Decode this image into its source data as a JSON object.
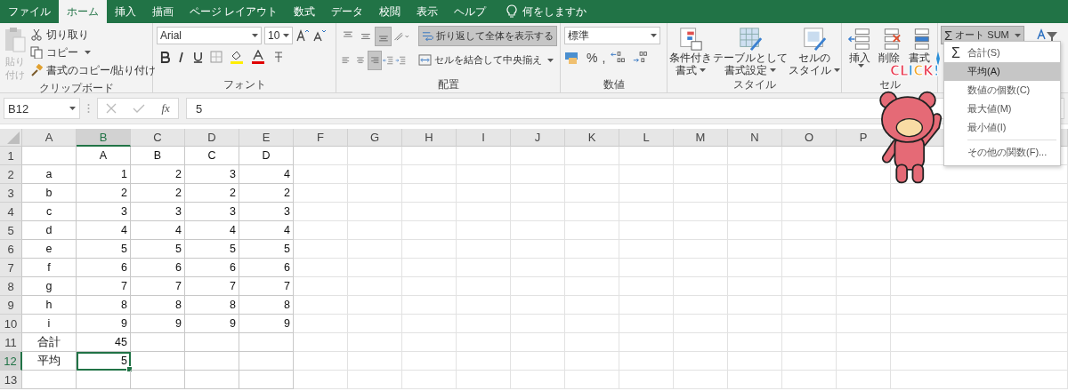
{
  "tabs": [
    {
      "label": "ファイル",
      "selected": false
    },
    {
      "label": "ホーム",
      "selected": true
    },
    {
      "label": "挿入",
      "selected": false
    },
    {
      "label": "描画",
      "selected": false
    },
    {
      "label": "ページ レイアウト",
      "selected": false
    },
    {
      "label": "数式",
      "selected": false
    },
    {
      "label": "データ",
      "selected": false
    },
    {
      "label": "校閲",
      "selected": false
    },
    {
      "label": "表示",
      "selected": false
    },
    {
      "label": "ヘルプ",
      "selected": false
    }
  ],
  "tell_me": "何をしますか",
  "ribbon": {
    "clipboard": {
      "label": "クリップボード",
      "paste": {
        "label": "貼り付け",
        "disabled": true
      },
      "cut": "切り取り",
      "copy": "コピー",
      "format_painter": "書式のコピー/貼り付け"
    },
    "font": {
      "label": "フォント",
      "name": "Arial",
      "size": "10"
    },
    "alignment": {
      "label": "配置",
      "wrap_text": {
        "label": "折り返して全体を表示する",
        "on": true
      },
      "merge": "セルを結合して中央揃え"
    },
    "number": {
      "label": "数値",
      "format": "標準",
      "percent": "%",
      "comma": ","
    },
    "styles": {
      "label": "スタイル",
      "buttons": [
        {
          "lines": [
            "条件付き",
            "書式"
          ]
        },
        {
          "lines": [
            "テーブルとして",
            "書式設定"
          ]
        },
        {
          "lines": [
            "セルの",
            "スタイル"
          ]
        }
      ]
    },
    "cells": {
      "label": "セル",
      "buttons": [
        "挿入",
        "削除",
        "書式"
      ]
    },
    "editing": {
      "autosum": {
        "icon": "Σ",
        "label": "オート SUM",
        "pressed": true
      }
    }
  },
  "formula_bar": {
    "name_box": "B12",
    "fx": "fx",
    "value": "5"
  },
  "sheet": {
    "columns": [
      {
        "label": "A",
        "selected": false
      },
      {
        "label": "B",
        "selected": true
      },
      {
        "label": "C",
        "selected": false
      },
      {
        "label": "D",
        "selected": false
      },
      {
        "label": "E",
        "selected": false
      },
      {
        "label": "F",
        "selected": false
      },
      {
        "label": "G",
        "selected": false
      },
      {
        "label": "H",
        "selected": false
      },
      {
        "label": "I",
        "selected": false
      },
      {
        "label": "J",
        "selected": false
      },
      {
        "label": "K",
        "selected": false
      },
      {
        "label": "L",
        "selected": false
      },
      {
        "label": "M",
        "selected": false
      },
      {
        "label": "N",
        "selected": false
      },
      {
        "label": "O",
        "selected": false
      },
      {
        "label": "P",
        "selected": false
      }
    ],
    "rows": [
      {
        "label": "1",
        "selected": false,
        "cells": {
          "B": "A",
          "C": "B",
          "D": "C",
          "E": "D"
        }
      },
      {
        "label": "2",
        "selected": false,
        "cells": {
          "A": "a",
          "B": "1",
          "C": "2",
          "D": "3",
          "E": "4"
        }
      },
      {
        "label": "3",
        "selected": false,
        "cells": {
          "A": "b",
          "B": "2",
          "C": "2",
          "D": "2",
          "E": "2"
        }
      },
      {
        "label": "4",
        "selected": false,
        "cells": {
          "A": "c",
          "B": "3",
          "C": "3",
          "D": "3",
          "E": "3"
        }
      },
      {
        "label": "5",
        "selected": false,
        "cells": {
          "A": "d",
          "B": "4",
          "C": "4",
          "D": "4",
          "E": "4"
        }
      },
      {
        "label": "6",
        "selected": false,
        "cells": {
          "A": "e",
          "B": "5",
          "C": "5",
          "D": "5",
          "E": "5"
        }
      },
      {
        "label": "7",
        "selected": false,
        "cells": {
          "A": "f",
          "B": "6",
          "C": "6",
          "D": "6",
          "E": "6"
        }
      },
      {
        "label": "8",
        "selected": false,
        "cells": {
          "A": "g",
          "B": "7",
          "C": "7",
          "D": "7",
          "E": "7"
        }
      },
      {
        "label": "9",
        "selected": false,
        "cells": {
          "A": "h",
          "B": "8",
          "C": "8",
          "D": "8",
          "E": "8"
        }
      },
      {
        "label": "10",
        "selected": false,
        "cells": {
          "A": "i",
          "B": "9",
          "C": "9",
          "D": "9",
          "E": "9"
        }
      },
      {
        "label": "11",
        "selected": false,
        "cells": {
          "A": "合計",
          "B": "45"
        }
      },
      {
        "label": "12",
        "selected": true,
        "cells": {
          "A": "平均",
          "B": "5"
        }
      },
      {
        "label": "13",
        "selected": false,
        "cells": {}
      }
    ]
  },
  "autosum_menu": {
    "items": [
      {
        "icon": "Σ",
        "label": "合計(S)",
        "selected": false
      },
      {
        "label": "平均(A)",
        "selected": true
      },
      {
        "label": "数値の個数(C)",
        "selected": false
      },
      {
        "label": "最大値(M)",
        "selected": false
      },
      {
        "label": "最小値(I)",
        "selected": false
      }
    ],
    "more": "その他の関数(F)..."
  },
  "sticker": {
    "text": "CLICK!"
  }
}
